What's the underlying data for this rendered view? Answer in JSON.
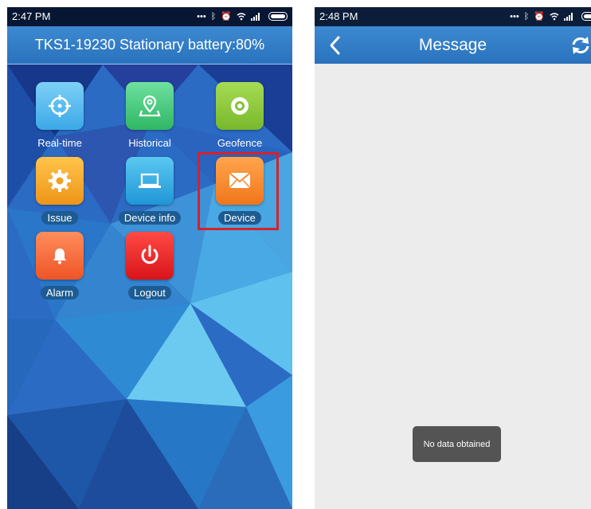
{
  "left_phone": {
    "status_bar": {
      "time": "2:47 PM",
      "icons": [
        "more-icon",
        "bluetooth-icon",
        "alarm-icon",
        "wifi-icon",
        "signal-icon",
        "battery-icon"
      ]
    },
    "title": "TKS1-19230 Stationary battery:80%",
    "menu": [
      {
        "label": "Real-time",
        "icon": "crosshair-icon",
        "color": "#4fb4ec"
      },
      {
        "label": "Historical",
        "icon": "map-pin-icon",
        "color": "#45c77a"
      },
      {
        "label": "Geofence",
        "icon": "target-icon",
        "color": "#8cc63f"
      },
      {
        "label": "Issue",
        "icon": "gear-icon",
        "color": "#f4a62a"
      },
      {
        "label": "Device info",
        "icon": "laptop-icon",
        "color": "#2fa9e0"
      },
      {
        "label": "Device",
        "icon": "envelope-icon",
        "color": "#f58a2d"
      },
      {
        "label": "Alarm",
        "icon": "bell-icon",
        "color": "#f46a3a"
      },
      {
        "label": "Logout",
        "icon": "power-icon",
        "color": "#e8282c"
      }
    ]
  },
  "right_phone": {
    "status_bar": {
      "time": "2:48 PM",
      "icons": [
        "more-icon",
        "bluetooth-icon",
        "alarm-icon",
        "wifi-icon",
        "signal-icon",
        "battery-icon"
      ]
    },
    "title": "Message",
    "toast": "No data obtained"
  },
  "colors": {
    "header_blue": "#2f7cc6",
    "highlight_red": "#d6212a"
  }
}
